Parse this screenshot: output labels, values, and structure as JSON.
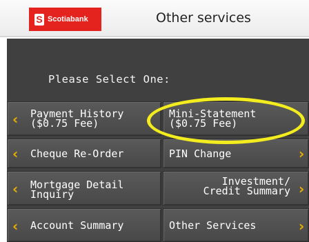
{
  "header": {
    "brand": "Scotiabank",
    "brand_mark": "S",
    "title": "Other services"
  },
  "screen": {
    "prompt": "Please Select One:"
  },
  "menu": {
    "payment_history": "Payment History\n($0.75 Fee)",
    "mini_statement": "Mini-Statement\n($0.75 Fee)",
    "cheque_reorder": "Cheque Re-Order",
    "pin_change": "PIN Change",
    "mortgage_detail": "Mortgage Detail\nInquiry",
    "investment_summary": "Investment/\nCredit Summary",
    "account_summary": "Account Summary",
    "other_services": "Other Services"
  },
  "icons": {
    "left_arrow": "chevron-left-icon",
    "right_arrow": "chevron-right-icon"
  },
  "colors": {
    "brand_red": "#e4231f",
    "screen_bg": "#404040",
    "button_bg": "#505050",
    "arrow": "#e8b000",
    "highlight": "#f3ec1e"
  }
}
